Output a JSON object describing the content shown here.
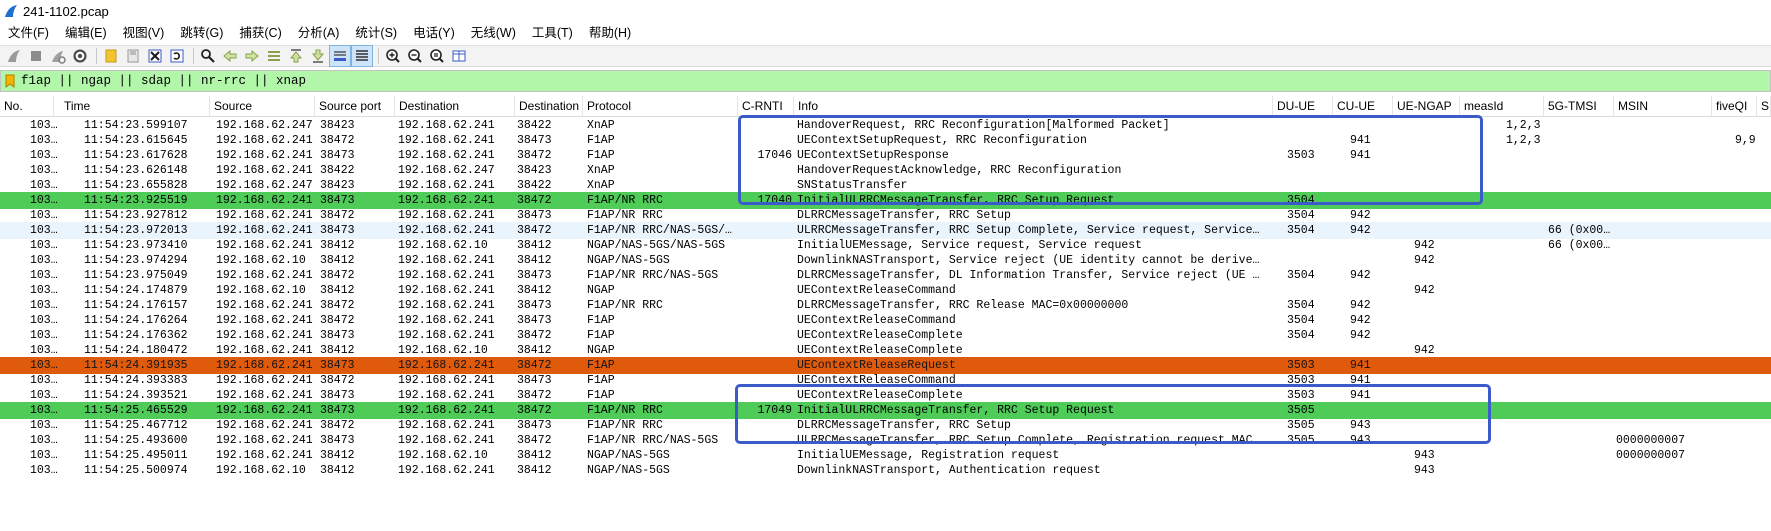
{
  "window": {
    "title": "241-1102.pcap"
  },
  "menu": [
    "文件(F)",
    "编辑(E)",
    "视图(V)",
    "跳转(G)",
    "捕获(C)",
    "分析(A)",
    "统计(S)",
    "电话(Y)",
    "无线(W)",
    "工具(T)",
    "帮助(H)"
  ],
  "toolbar": {
    "buttons": [
      "start-capture-icon",
      "stop-capture-icon",
      "restart-capture-icon",
      "capture-options-icon",
      "open-file-icon",
      "save-file-icon",
      "close-file-icon",
      "reload-file-icon",
      "find-packet-icon",
      "go-back-icon",
      "go-forward-icon",
      "go-to-packet-icon",
      "go-first-icon",
      "go-last-icon",
      "autoscroll-icon",
      "colorize-icon",
      "zoom-in-icon",
      "zoom-out-icon",
      "zoom-normal-icon",
      "resize-columns-icon"
    ]
  },
  "filter": {
    "text": "f1ap || ngap || sdap || nr-rrc || xnap"
  },
  "columns": [
    "No.",
    "Time",
    "Source",
    "Source port",
    "Destination",
    "Destination",
    "Protocol",
    "C-RNTI",
    "Info",
    "DU-UE",
    "CU-UE",
    "UE-NGAP",
    "measId",
    "5G-TMSI",
    "MSIN",
    "fiveQI",
    "S"
  ],
  "packets": [
    {
      "no": "103…",
      "time": "11:54:23.599107",
      "src": "192.168.62.247",
      "sport": "38423",
      "dst": "192.168.62.241",
      "dport": "38422",
      "proto": "XnAP",
      "crnti": "",
      "info": "HandoverRequest, RRC Reconfiguration[Malformed Packet]",
      "duue": "",
      "cuue": "",
      "ngap": "",
      "meas": "1,2,3",
      "tmsi": "",
      "msin": "",
      "fiveqi": "",
      "style": ""
    },
    {
      "no": "103…",
      "time": "11:54:23.615645",
      "src": "192.168.62.241",
      "sport": "38472",
      "dst": "192.168.62.241",
      "dport": "38473",
      "proto": "F1AP",
      "crnti": "",
      "info": "UEContextSetupRequest, RRC Reconfiguration",
      "duue": "",
      "cuue": "941",
      "ngap": "",
      "meas": "1,2,3",
      "tmsi": "",
      "msin": "",
      "fiveqi": "9,9",
      "style": ""
    },
    {
      "no": "103…",
      "time": "11:54:23.617628",
      "src": "192.168.62.241",
      "sport": "38473",
      "dst": "192.168.62.241",
      "dport": "38472",
      "proto": "F1AP",
      "crnti": "17046",
      "info": "UEContextSetupResponse",
      "duue": "3503",
      "cuue": "941",
      "ngap": "",
      "meas": "",
      "tmsi": "",
      "msin": "",
      "fiveqi": "",
      "style": ""
    },
    {
      "no": "103…",
      "time": "11:54:23.626148",
      "src": "192.168.62.241",
      "sport": "38422",
      "dst": "192.168.62.247",
      "dport": "38423",
      "proto": "XnAP",
      "crnti": "",
      "info": "HandoverRequestAcknowledge, RRC Reconfiguration",
      "duue": "",
      "cuue": "",
      "ngap": "",
      "meas": "",
      "tmsi": "",
      "msin": "",
      "fiveqi": "",
      "style": ""
    },
    {
      "no": "103…",
      "time": "11:54:23.655828",
      "src": "192.168.62.247",
      "sport": "38423",
      "dst": "192.168.62.241",
      "dport": "38422",
      "proto": "XnAP",
      "crnti": "",
      "info": "SNStatusTransfer",
      "duue": "",
      "cuue": "",
      "ngap": "",
      "meas": "",
      "tmsi": "",
      "msin": "",
      "fiveqi": "",
      "style": ""
    },
    {
      "no": "103…",
      "time": "11:54:23.925519",
      "src": "192.168.62.241",
      "sport": "38473",
      "dst": "192.168.62.241",
      "dport": "38472",
      "proto": "F1AP/NR RRC",
      "crnti": "17040",
      "info": "InitialULRRCMessageTransfer, RRC Setup Request",
      "duue": "3504",
      "cuue": "",
      "ngap": "",
      "meas": "",
      "tmsi": "",
      "msin": "",
      "fiveqi": "",
      "style": "green"
    },
    {
      "no": "103…",
      "time": "11:54:23.927812",
      "src": "192.168.62.241",
      "sport": "38472",
      "dst": "192.168.62.241",
      "dport": "38473",
      "proto": "F1AP/NR RRC",
      "crnti": "",
      "info": "DLRRCMessageTransfer, RRC Setup",
      "duue": "3504",
      "cuue": "942",
      "ngap": "",
      "meas": "",
      "tmsi": "",
      "msin": "",
      "fiveqi": "",
      "style": ""
    },
    {
      "no": "103…",
      "time": "11:54:23.972013",
      "src": "192.168.62.241",
      "sport": "38473",
      "dst": "192.168.62.241",
      "dport": "38472",
      "proto": "F1AP/NR RRC/NAS-5GS/…",
      "crnti": "",
      "info": "ULRRCMessageTransfer, RRC Setup Complete, Service request, Service…",
      "duue": "3504",
      "cuue": "942",
      "ngap": "",
      "meas": "",
      "tmsi": "66 (0x00…",
      "msin": "",
      "fiveqi": "",
      "style": "lightblue"
    },
    {
      "no": "103…",
      "time": "11:54:23.973410",
      "src": "192.168.62.241",
      "sport": "38412",
      "dst": "192.168.62.10",
      "dport": "38412",
      "proto": "NGAP/NAS-5GS/NAS-5GS",
      "crnti": "",
      "info": "InitialUEMessage, Service request, Service request",
      "duue": "",
      "cuue": "",
      "ngap": "942",
      "meas": "",
      "tmsi": "66 (0x00…",
      "msin": "",
      "fiveqi": "",
      "style": ""
    },
    {
      "no": "103…",
      "time": "11:54:23.974294",
      "src": "192.168.62.10",
      "sport": "38412",
      "dst": "192.168.62.241",
      "dport": "38412",
      "proto": "NGAP/NAS-5GS",
      "crnti": "",
      "info": "DownlinkNASTransport, Service reject (UE identity cannot be derive…",
      "duue": "",
      "cuue": "",
      "ngap": "942",
      "meas": "",
      "tmsi": "",
      "msin": "",
      "fiveqi": "",
      "style": ""
    },
    {
      "no": "103…",
      "time": "11:54:23.975049",
      "src": "192.168.62.241",
      "sport": "38472",
      "dst": "192.168.62.241",
      "dport": "38473",
      "proto": "F1AP/NR RRC/NAS-5GS",
      "crnti": "",
      "info": "DLRRCMessageTransfer, DL Information Transfer, Service reject (UE …",
      "duue": "3504",
      "cuue": "942",
      "ngap": "",
      "meas": "",
      "tmsi": "",
      "msin": "",
      "fiveqi": "",
      "style": ""
    },
    {
      "no": "103…",
      "time": "11:54:24.174879",
      "src": "192.168.62.10",
      "sport": "38412",
      "dst": "192.168.62.241",
      "dport": "38412",
      "proto": "NGAP",
      "crnti": "",
      "info": "UEContextReleaseCommand",
      "duue": "",
      "cuue": "",
      "ngap": "942",
      "meas": "",
      "tmsi": "",
      "msin": "",
      "fiveqi": "",
      "style": ""
    },
    {
      "no": "103…",
      "time": "11:54:24.176157",
      "src": "192.168.62.241",
      "sport": "38472",
      "dst": "192.168.62.241",
      "dport": "38473",
      "proto": "F1AP/NR RRC",
      "crnti": "",
      "info": "DLRRCMessageTransfer, RRC Release MAC=0x00000000",
      "duue": "3504",
      "cuue": "942",
      "ngap": "",
      "meas": "",
      "tmsi": "",
      "msin": "",
      "fiveqi": "",
      "style": ""
    },
    {
      "no": "103…",
      "time": "11:54:24.176264",
      "src": "192.168.62.241",
      "sport": "38472",
      "dst": "192.168.62.241",
      "dport": "38473",
      "proto": "F1AP",
      "crnti": "",
      "info": "UEContextReleaseCommand",
      "duue": "3504",
      "cuue": "942",
      "ngap": "",
      "meas": "",
      "tmsi": "",
      "msin": "",
      "fiveqi": "",
      "style": ""
    },
    {
      "no": "103…",
      "time": "11:54:24.176362",
      "src": "192.168.62.241",
      "sport": "38473",
      "dst": "192.168.62.241",
      "dport": "38472",
      "proto": "F1AP",
      "crnti": "",
      "info": "UEContextReleaseComplete",
      "duue": "3504",
      "cuue": "942",
      "ngap": "",
      "meas": "",
      "tmsi": "",
      "msin": "",
      "fiveqi": "",
      "style": ""
    },
    {
      "no": "103…",
      "time": "11:54:24.180472",
      "src": "192.168.62.241",
      "sport": "38412",
      "dst": "192.168.62.10",
      "dport": "38412",
      "proto": "NGAP",
      "crnti": "",
      "info": "UEContextReleaseComplete",
      "duue": "",
      "cuue": "",
      "ngap": "942",
      "meas": "",
      "tmsi": "",
      "msin": "",
      "fiveqi": "",
      "style": ""
    },
    {
      "no": "103…",
      "time": "11:54:24.391935",
      "src": "192.168.62.241",
      "sport": "38473",
      "dst": "192.168.62.241",
      "dport": "38472",
      "proto": "F1AP",
      "crnti": "",
      "info": "UEContextReleaseRequest",
      "duue": "3503",
      "cuue": "941",
      "ngap": "",
      "meas": "",
      "tmsi": "",
      "msin": "",
      "fiveqi": "",
      "style": "orange"
    },
    {
      "no": "103…",
      "time": "11:54:24.393383",
      "src": "192.168.62.241",
      "sport": "38472",
      "dst": "192.168.62.241",
      "dport": "38473",
      "proto": "F1AP",
      "crnti": "",
      "info": "UEContextReleaseCommand",
      "duue": "3503",
      "cuue": "941",
      "ngap": "",
      "meas": "",
      "tmsi": "",
      "msin": "",
      "fiveqi": "",
      "style": ""
    },
    {
      "no": "103…",
      "time": "11:54:24.393521",
      "src": "192.168.62.241",
      "sport": "38473",
      "dst": "192.168.62.241",
      "dport": "38472",
      "proto": "F1AP",
      "crnti": "",
      "info": "UEContextReleaseComplete",
      "duue": "3503",
      "cuue": "941",
      "ngap": "",
      "meas": "",
      "tmsi": "",
      "msin": "",
      "fiveqi": "",
      "style": ""
    },
    {
      "no": "103…",
      "time": "11:54:25.465529",
      "src": "192.168.62.241",
      "sport": "38473",
      "dst": "192.168.62.241",
      "dport": "38472",
      "proto": "F1AP/NR RRC",
      "crnti": "17049",
      "info": "InitialULRRCMessageTransfer, RRC Setup Request",
      "duue": "3505",
      "cuue": "",
      "ngap": "",
      "meas": "",
      "tmsi": "",
      "msin": "",
      "fiveqi": "",
      "style": "green"
    },
    {
      "no": "103…",
      "time": "11:54:25.467712",
      "src": "192.168.62.241",
      "sport": "38472",
      "dst": "192.168.62.241",
      "dport": "38473",
      "proto": "F1AP/NR RRC",
      "crnti": "",
      "info": "DLRRCMessageTransfer, RRC Setup",
      "duue": "3505",
      "cuue": "943",
      "ngap": "",
      "meas": "",
      "tmsi": "",
      "msin": "",
      "fiveqi": "",
      "style": ""
    },
    {
      "no": "103…",
      "time": "11:54:25.493600",
      "src": "192.168.62.241",
      "sport": "38473",
      "dst": "192.168.62.241",
      "dport": "38472",
      "proto": "F1AP/NR RRC/NAS-5GS",
      "crnti": "",
      "info": "ULRRCMessageTransfer, RRC Setup Complete, Registration request MAC…",
      "duue": "3505",
      "cuue": "943",
      "ngap": "",
      "meas": "",
      "tmsi": "",
      "msin": "0000000007",
      "fiveqi": "",
      "style": ""
    },
    {
      "no": "103…",
      "time": "11:54:25.495011",
      "src": "192.168.62.241",
      "sport": "38412",
      "dst": "192.168.62.10",
      "dport": "38412",
      "proto": "NGAP/NAS-5GS",
      "crnti": "",
      "info": "InitialUEMessage, Registration request",
      "duue": "",
      "cuue": "",
      "ngap": "943",
      "meas": "",
      "tmsi": "",
      "msin": "0000000007",
      "fiveqi": "",
      "style": ""
    },
    {
      "no": "103…",
      "time": "11:54:25.500974",
      "src": "192.168.62.10",
      "sport": "38412",
      "dst": "192.168.62.241",
      "dport": "38412",
      "proto": "NGAP/NAS-5GS",
      "crnti": "",
      "info": "DownlinkNASTransport, Authentication request",
      "duue": "",
      "cuue": "",
      "ngap": "943",
      "meas": "",
      "tmsi": "",
      "msin": "",
      "fiveqi": "",
      "style": ""
    }
  ],
  "colors": {
    "accent_box": "#3a5bc9",
    "green_row": "#4fcc57",
    "orange_row": "#e05a0b",
    "filter_bg": "#b1f6a9"
  }
}
